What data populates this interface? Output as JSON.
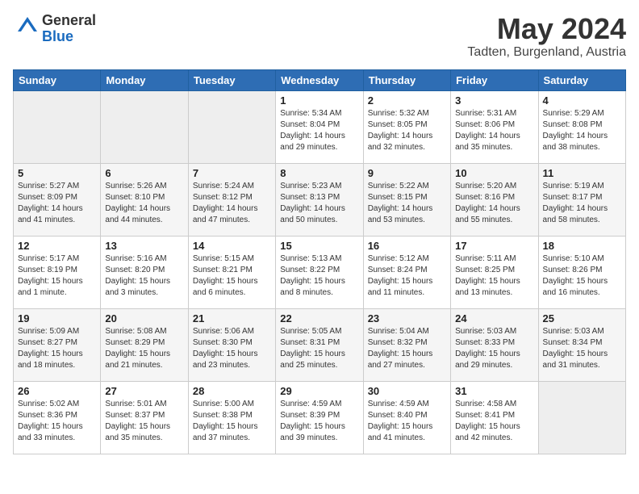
{
  "header": {
    "logo_line1": "General",
    "logo_line2": "Blue",
    "month": "May 2024",
    "location": "Tadten, Burgenland, Austria"
  },
  "days_of_week": [
    "Sunday",
    "Monday",
    "Tuesday",
    "Wednesday",
    "Thursday",
    "Friday",
    "Saturday"
  ],
  "weeks": [
    [
      {
        "day": "",
        "info": ""
      },
      {
        "day": "",
        "info": ""
      },
      {
        "day": "",
        "info": ""
      },
      {
        "day": "1",
        "info": "Sunrise: 5:34 AM\nSunset: 8:04 PM\nDaylight: 14 hours\nand 29 minutes."
      },
      {
        "day": "2",
        "info": "Sunrise: 5:32 AM\nSunset: 8:05 PM\nDaylight: 14 hours\nand 32 minutes."
      },
      {
        "day": "3",
        "info": "Sunrise: 5:31 AM\nSunset: 8:06 PM\nDaylight: 14 hours\nand 35 minutes."
      },
      {
        "day": "4",
        "info": "Sunrise: 5:29 AM\nSunset: 8:08 PM\nDaylight: 14 hours\nand 38 minutes."
      }
    ],
    [
      {
        "day": "5",
        "info": "Sunrise: 5:27 AM\nSunset: 8:09 PM\nDaylight: 14 hours\nand 41 minutes."
      },
      {
        "day": "6",
        "info": "Sunrise: 5:26 AM\nSunset: 8:10 PM\nDaylight: 14 hours\nand 44 minutes."
      },
      {
        "day": "7",
        "info": "Sunrise: 5:24 AM\nSunset: 8:12 PM\nDaylight: 14 hours\nand 47 minutes."
      },
      {
        "day": "8",
        "info": "Sunrise: 5:23 AM\nSunset: 8:13 PM\nDaylight: 14 hours\nand 50 minutes."
      },
      {
        "day": "9",
        "info": "Sunrise: 5:22 AM\nSunset: 8:15 PM\nDaylight: 14 hours\nand 53 minutes."
      },
      {
        "day": "10",
        "info": "Sunrise: 5:20 AM\nSunset: 8:16 PM\nDaylight: 14 hours\nand 55 minutes."
      },
      {
        "day": "11",
        "info": "Sunrise: 5:19 AM\nSunset: 8:17 PM\nDaylight: 14 hours\nand 58 minutes."
      }
    ],
    [
      {
        "day": "12",
        "info": "Sunrise: 5:17 AM\nSunset: 8:19 PM\nDaylight: 15 hours\nand 1 minute."
      },
      {
        "day": "13",
        "info": "Sunrise: 5:16 AM\nSunset: 8:20 PM\nDaylight: 15 hours\nand 3 minutes."
      },
      {
        "day": "14",
        "info": "Sunrise: 5:15 AM\nSunset: 8:21 PM\nDaylight: 15 hours\nand 6 minutes."
      },
      {
        "day": "15",
        "info": "Sunrise: 5:13 AM\nSunset: 8:22 PM\nDaylight: 15 hours\nand 8 minutes."
      },
      {
        "day": "16",
        "info": "Sunrise: 5:12 AM\nSunset: 8:24 PM\nDaylight: 15 hours\nand 11 minutes."
      },
      {
        "day": "17",
        "info": "Sunrise: 5:11 AM\nSunset: 8:25 PM\nDaylight: 15 hours\nand 13 minutes."
      },
      {
        "day": "18",
        "info": "Sunrise: 5:10 AM\nSunset: 8:26 PM\nDaylight: 15 hours\nand 16 minutes."
      }
    ],
    [
      {
        "day": "19",
        "info": "Sunrise: 5:09 AM\nSunset: 8:27 PM\nDaylight: 15 hours\nand 18 minutes."
      },
      {
        "day": "20",
        "info": "Sunrise: 5:08 AM\nSunset: 8:29 PM\nDaylight: 15 hours\nand 21 minutes."
      },
      {
        "day": "21",
        "info": "Sunrise: 5:06 AM\nSunset: 8:30 PM\nDaylight: 15 hours\nand 23 minutes."
      },
      {
        "day": "22",
        "info": "Sunrise: 5:05 AM\nSunset: 8:31 PM\nDaylight: 15 hours\nand 25 minutes."
      },
      {
        "day": "23",
        "info": "Sunrise: 5:04 AM\nSunset: 8:32 PM\nDaylight: 15 hours\nand 27 minutes."
      },
      {
        "day": "24",
        "info": "Sunrise: 5:03 AM\nSunset: 8:33 PM\nDaylight: 15 hours\nand 29 minutes."
      },
      {
        "day": "25",
        "info": "Sunrise: 5:03 AM\nSunset: 8:34 PM\nDaylight: 15 hours\nand 31 minutes."
      }
    ],
    [
      {
        "day": "26",
        "info": "Sunrise: 5:02 AM\nSunset: 8:36 PM\nDaylight: 15 hours\nand 33 minutes."
      },
      {
        "day": "27",
        "info": "Sunrise: 5:01 AM\nSunset: 8:37 PM\nDaylight: 15 hours\nand 35 minutes."
      },
      {
        "day": "28",
        "info": "Sunrise: 5:00 AM\nSunset: 8:38 PM\nDaylight: 15 hours\nand 37 minutes."
      },
      {
        "day": "29",
        "info": "Sunrise: 4:59 AM\nSunset: 8:39 PM\nDaylight: 15 hours\nand 39 minutes."
      },
      {
        "day": "30",
        "info": "Sunrise: 4:59 AM\nSunset: 8:40 PM\nDaylight: 15 hours\nand 41 minutes."
      },
      {
        "day": "31",
        "info": "Sunrise: 4:58 AM\nSunset: 8:41 PM\nDaylight: 15 hours\nand 42 minutes."
      },
      {
        "day": "",
        "info": ""
      }
    ]
  ]
}
